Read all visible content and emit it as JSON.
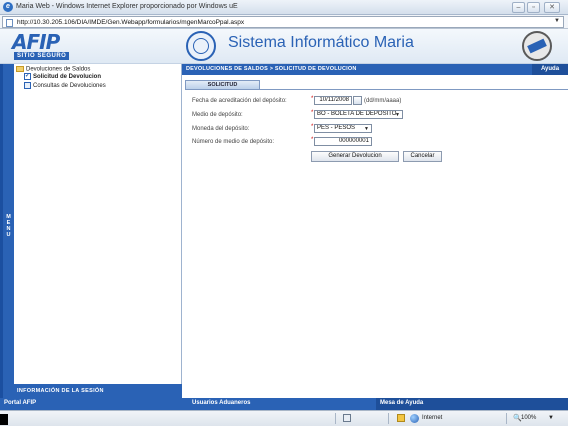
{
  "window": {
    "title": "Maria Web - Windows Internet Explorer proporcionado por Windows uE",
    "minimize_glyph": "–",
    "restore_glyph": "▫",
    "close_glyph": "✕"
  },
  "addressbar": {
    "url": "http://10.30.205.106/DIA/IMDE/Gen.Webapp/formularios/mgenMarcoPpal.aspx"
  },
  "header": {
    "logo_text": "AFIP",
    "logo_sub": "SITIO SEGURO",
    "app_title": "Sistema Informático Maria"
  },
  "sidebar": {
    "menu_label": "MENU",
    "tree": [
      {
        "label": "Devoluciones de Saldos",
        "icon": "folder-icon"
      },
      {
        "label": "Solicitud de Devolucion",
        "icon": "check-icon"
      },
      {
        "label": "Consultas de Devoluciones",
        "icon": "doc-icon"
      }
    ],
    "session_label": "INFORMACIÓN DE LA SESIÓN"
  },
  "breadcrumb": "DEVOLUCIONES DE SALDOS > SOLICITUD DE DEVOLUCION",
  "help_label": "Ayuda",
  "tab_label": "SOLICITUD",
  "form": {
    "fecha_label": "Fecha de acreditación del depósito:",
    "fecha_value": "10/11/2008",
    "fecha_hint": "(dd/mm/aaaa)",
    "medio_label": "Medio de depósito:",
    "medio_value": "BO - BOLETA DE DEPOSITO",
    "moneda_label": "Moneda del depósito:",
    "moneda_value": "PES - PESOS",
    "numero_label": "Número de medio de depósito:",
    "numero_value": "000000001",
    "required_mark": "*",
    "generar_label": "Generar Devolucion",
    "cancelar_label": "Cancelar"
  },
  "footer": {
    "portal": "Portal AFIP",
    "usuarios": "Usuarios Aduaneros",
    "mesa": "Mesa de Ayuda"
  },
  "statusbar": {
    "zone": "Internet",
    "zoom": "100%"
  }
}
